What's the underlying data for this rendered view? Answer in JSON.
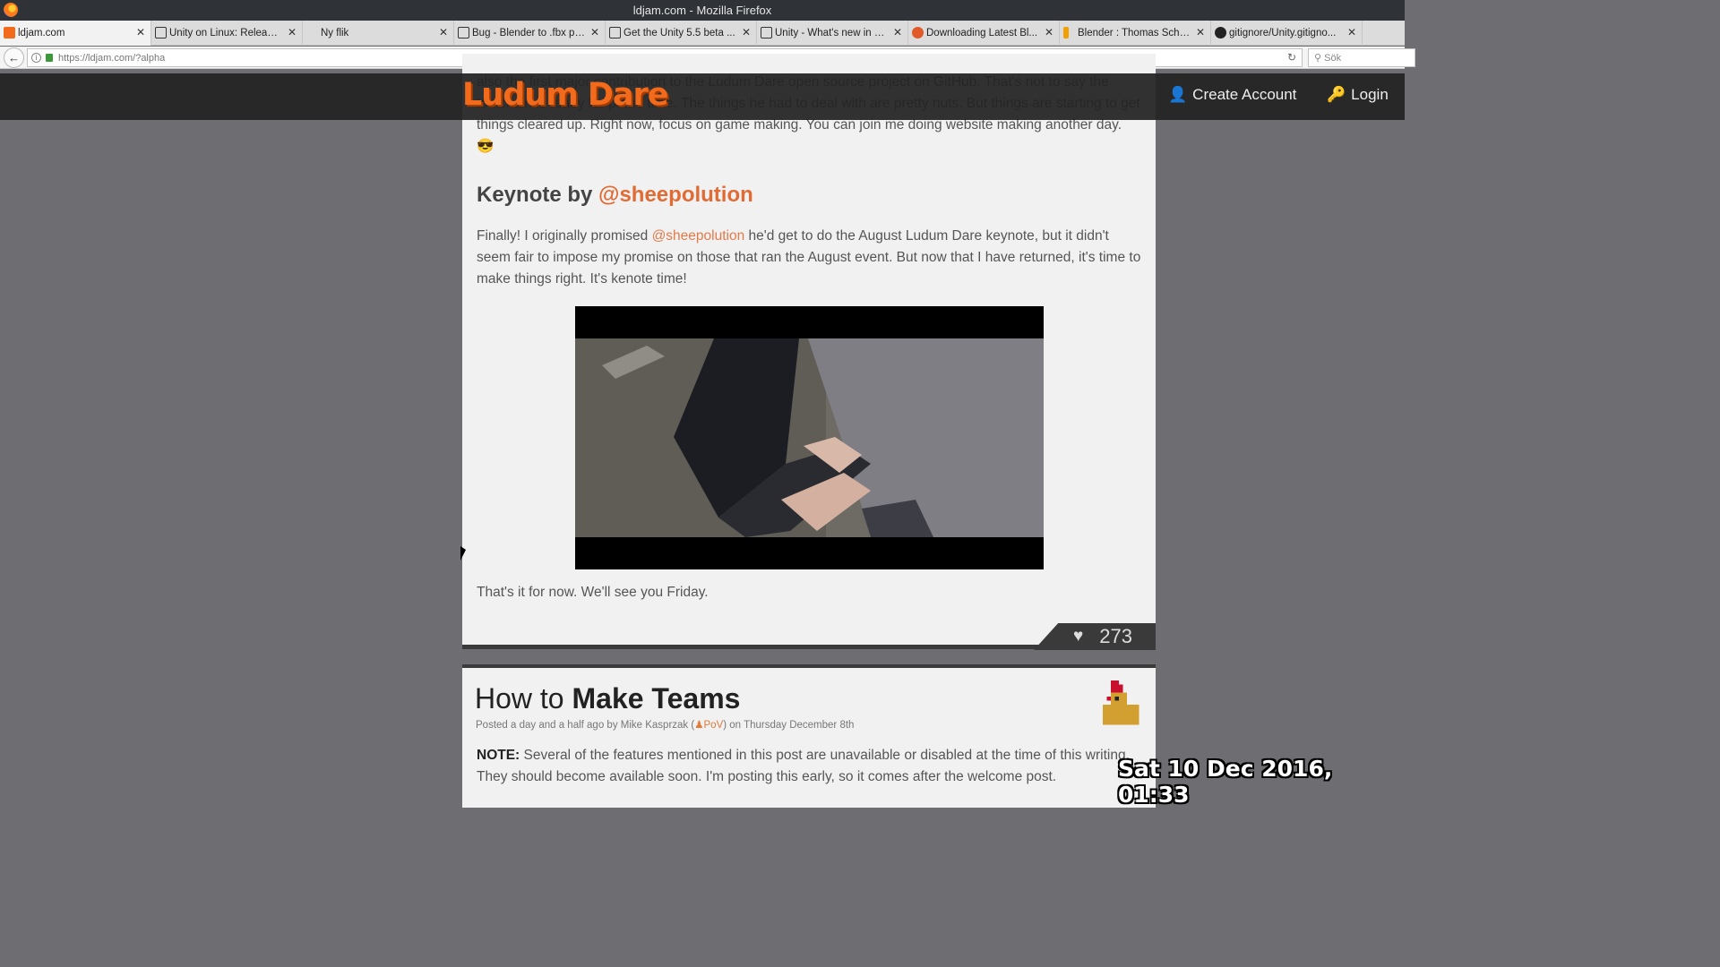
{
  "window": {
    "title": "ldjam.com - Mozilla Firefox"
  },
  "tabs": [
    {
      "label": "ldjam.com",
      "icon": "ldjam-favicon",
      "color": "#f26a1b",
      "active": true
    },
    {
      "label": "Unity on Linux: Release...",
      "icon": "unity-favicon",
      "color": "#333333"
    },
    {
      "label": "Ny flik",
      "icon": "",
      "color": ""
    },
    {
      "label": "Bug - Blender to .fbx pr...",
      "icon": "unity-favicon",
      "color": "#333333"
    },
    {
      "label": "Get the Unity 5.5 beta ...",
      "icon": "unity-favicon",
      "color": "#333333"
    },
    {
      "label": "Unity - What's new in U...",
      "icon": "unity-favicon",
      "color": "#333333"
    },
    {
      "label": "Downloading Latest Bl...",
      "icon": "ask-favicon",
      "color": "#e05a2a"
    },
    {
      "label": "Blender : Thomas Schiex",
      "icon": "launchpad-favicon",
      "color": "#f0a000"
    },
    {
      "label": "gitignore/Unity.gitigno...",
      "icon": "github-favicon",
      "color": "#222222"
    }
  ],
  "navbar": {
    "url": "https://ldjam.com/?alpha",
    "search_placeholder": "Sök"
  },
  "site": {
    "logo": "Ludum Dare",
    "create_account": "Create Account",
    "login": "Login",
    "brand_color": "#f26a1b"
  },
  "article": {
    "partial_pre": "",
    "partial_text": "also the first major contribution to the Ludum Dare open source project on GitHub. That's not to say the toolchain is ready for prime time. The things he had to deal with are pretty nuts. But things are starting to get things cleared up. Right now, focus on game making. You can join me doing website making another day.",
    "emoji": "😎",
    "heading_prefix": "Keynote by",
    "heading_mention": "@sheepolution",
    "p2_start": "Finally! I originally promised",
    "p2_mention": "@sheepolution",
    "p2_rest": "he'd get to do the August Ludum Dare keynote, but it didn't seem fair to impose my promise on those that ran the August event. But now that I have returned, it's time to make things right. It's kenote time!",
    "p3": "That's it for now. We'll see you Friday.",
    "love_count": "273"
  },
  "article2": {
    "title_light": "How to",
    "title_bold": "Make Teams",
    "meta_prefix": "Posted a day and a half ago by Mike Kasprzak (",
    "meta_pov": "PoV",
    "meta_suffix": ") on Thursday December 8th",
    "note_label": "NOTE:",
    "note_text": "Several of the features mentioned in this post are unavailable or disabled at the time of this writing. They should become available soon. I'm posting this early, so it comes after the welcome post."
  },
  "overlay": {
    "datetime": "Sat 10 Dec 2016, 01:33"
  }
}
